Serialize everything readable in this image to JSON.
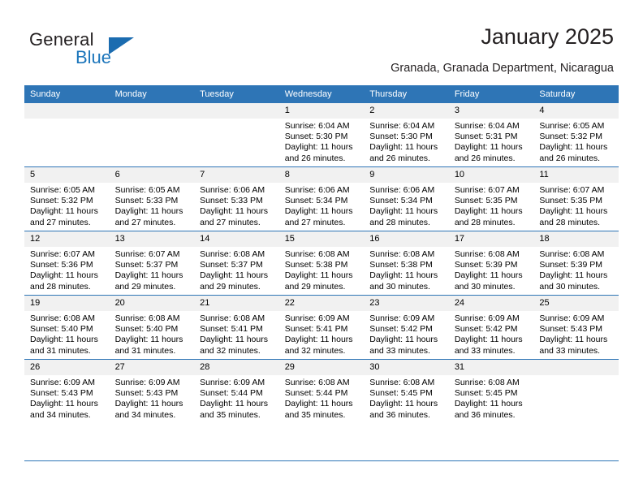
{
  "brand": {
    "name_part1": "General",
    "name_part2": "Blue",
    "accent_color": "#1b75bb",
    "triangle_icon": "triangle-icon"
  },
  "header": {
    "title": "January 2025",
    "subtitle": "Granada, Granada Department, Nicaragua"
  },
  "calendar": {
    "header_bg": "#2e75b6",
    "daynum_bg": "#f1f1f1",
    "weekday_headers": [
      "Sunday",
      "Monday",
      "Tuesday",
      "Wednesday",
      "Thursday",
      "Friday",
      "Saturday"
    ],
    "labels": {
      "sunrise": "Sunrise:",
      "sunset": "Sunset:",
      "daylight": "Daylight:"
    },
    "weeks": [
      [
        {
          "day": "",
          "sunrise": "",
          "sunset": "",
          "daylight": ""
        },
        {
          "day": "",
          "sunrise": "",
          "sunset": "",
          "daylight": ""
        },
        {
          "day": "",
          "sunrise": "",
          "sunset": "",
          "daylight": ""
        },
        {
          "day": "1",
          "sunrise": "Sunrise: 6:04 AM",
          "sunset": "Sunset: 5:30 PM",
          "daylight": "Daylight: 11 hours and 26 minutes."
        },
        {
          "day": "2",
          "sunrise": "Sunrise: 6:04 AM",
          "sunset": "Sunset: 5:30 PM",
          "daylight": "Daylight: 11 hours and 26 minutes."
        },
        {
          "day": "3",
          "sunrise": "Sunrise: 6:04 AM",
          "sunset": "Sunset: 5:31 PM",
          "daylight": "Daylight: 11 hours and 26 minutes."
        },
        {
          "day": "4",
          "sunrise": "Sunrise: 6:05 AM",
          "sunset": "Sunset: 5:32 PM",
          "daylight": "Daylight: 11 hours and 26 minutes."
        }
      ],
      [
        {
          "day": "5",
          "sunrise": "Sunrise: 6:05 AM",
          "sunset": "Sunset: 5:32 PM",
          "daylight": "Daylight: 11 hours and 27 minutes."
        },
        {
          "day": "6",
          "sunrise": "Sunrise: 6:05 AM",
          "sunset": "Sunset: 5:33 PM",
          "daylight": "Daylight: 11 hours and 27 minutes."
        },
        {
          "day": "7",
          "sunrise": "Sunrise: 6:06 AM",
          "sunset": "Sunset: 5:33 PM",
          "daylight": "Daylight: 11 hours and 27 minutes."
        },
        {
          "day": "8",
          "sunrise": "Sunrise: 6:06 AM",
          "sunset": "Sunset: 5:34 PM",
          "daylight": "Daylight: 11 hours and 27 minutes."
        },
        {
          "day": "9",
          "sunrise": "Sunrise: 6:06 AM",
          "sunset": "Sunset: 5:34 PM",
          "daylight": "Daylight: 11 hours and 28 minutes."
        },
        {
          "day": "10",
          "sunrise": "Sunrise: 6:07 AM",
          "sunset": "Sunset: 5:35 PM",
          "daylight": "Daylight: 11 hours and 28 minutes."
        },
        {
          "day": "11",
          "sunrise": "Sunrise: 6:07 AM",
          "sunset": "Sunset: 5:35 PM",
          "daylight": "Daylight: 11 hours and 28 minutes."
        }
      ],
      [
        {
          "day": "12",
          "sunrise": "Sunrise: 6:07 AM",
          "sunset": "Sunset: 5:36 PM",
          "daylight": "Daylight: 11 hours and 28 minutes."
        },
        {
          "day": "13",
          "sunrise": "Sunrise: 6:07 AM",
          "sunset": "Sunset: 5:37 PM",
          "daylight": "Daylight: 11 hours and 29 minutes."
        },
        {
          "day": "14",
          "sunrise": "Sunrise: 6:08 AM",
          "sunset": "Sunset: 5:37 PM",
          "daylight": "Daylight: 11 hours and 29 minutes."
        },
        {
          "day": "15",
          "sunrise": "Sunrise: 6:08 AM",
          "sunset": "Sunset: 5:38 PM",
          "daylight": "Daylight: 11 hours and 29 minutes."
        },
        {
          "day": "16",
          "sunrise": "Sunrise: 6:08 AM",
          "sunset": "Sunset: 5:38 PM",
          "daylight": "Daylight: 11 hours and 30 minutes."
        },
        {
          "day": "17",
          "sunrise": "Sunrise: 6:08 AM",
          "sunset": "Sunset: 5:39 PM",
          "daylight": "Daylight: 11 hours and 30 minutes."
        },
        {
          "day": "18",
          "sunrise": "Sunrise: 6:08 AM",
          "sunset": "Sunset: 5:39 PM",
          "daylight": "Daylight: 11 hours and 30 minutes."
        }
      ],
      [
        {
          "day": "19",
          "sunrise": "Sunrise: 6:08 AM",
          "sunset": "Sunset: 5:40 PM",
          "daylight": "Daylight: 11 hours and 31 minutes."
        },
        {
          "day": "20",
          "sunrise": "Sunrise: 6:08 AM",
          "sunset": "Sunset: 5:40 PM",
          "daylight": "Daylight: 11 hours and 31 minutes."
        },
        {
          "day": "21",
          "sunrise": "Sunrise: 6:08 AM",
          "sunset": "Sunset: 5:41 PM",
          "daylight": "Daylight: 11 hours and 32 minutes."
        },
        {
          "day": "22",
          "sunrise": "Sunrise: 6:09 AM",
          "sunset": "Sunset: 5:41 PM",
          "daylight": "Daylight: 11 hours and 32 minutes."
        },
        {
          "day": "23",
          "sunrise": "Sunrise: 6:09 AM",
          "sunset": "Sunset: 5:42 PM",
          "daylight": "Daylight: 11 hours and 33 minutes."
        },
        {
          "day": "24",
          "sunrise": "Sunrise: 6:09 AM",
          "sunset": "Sunset: 5:42 PM",
          "daylight": "Daylight: 11 hours and 33 minutes."
        },
        {
          "day": "25",
          "sunrise": "Sunrise: 6:09 AM",
          "sunset": "Sunset: 5:43 PM",
          "daylight": "Daylight: 11 hours and 33 minutes."
        }
      ],
      [
        {
          "day": "26",
          "sunrise": "Sunrise: 6:09 AM",
          "sunset": "Sunset: 5:43 PM",
          "daylight": "Daylight: 11 hours and 34 minutes."
        },
        {
          "day": "27",
          "sunrise": "Sunrise: 6:09 AM",
          "sunset": "Sunset: 5:43 PM",
          "daylight": "Daylight: 11 hours and 34 minutes."
        },
        {
          "day": "28",
          "sunrise": "Sunrise: 6:09 AM",
          "sunset": "Sunset: 5:44 PM",
          "daylight": "Daylight: 11 hours and 35 minutes."
        },
        {
          "day": "29",
          "sunrise": "Sunrise: 6:08 AM",
          "sunset": "Sunset: 5:44 PM",
          "daylight": "Daylight: 11 hours and 35 minutes."
        },
        {
          "day": "30",
          "sunrise": "Sunrise: 6:08 AM",
          "sunset": "Sunset: 5:45 PM",
          "daylight": "Daylight: 11 hours and 36 minutes."
        },
        {
          "day": "31",
          "sunrise": "Sunrise: 6:08 AM",
          "sunset": "Sunset: 5:45 PM",
          "daylight": "Daylight: 11 hours and 36 minutes."
        },
        {
          "day": "",
          "sunrise": "",
          "sunset": "",
          "daylight": ""
        }
      ]
    ]
  }
}
